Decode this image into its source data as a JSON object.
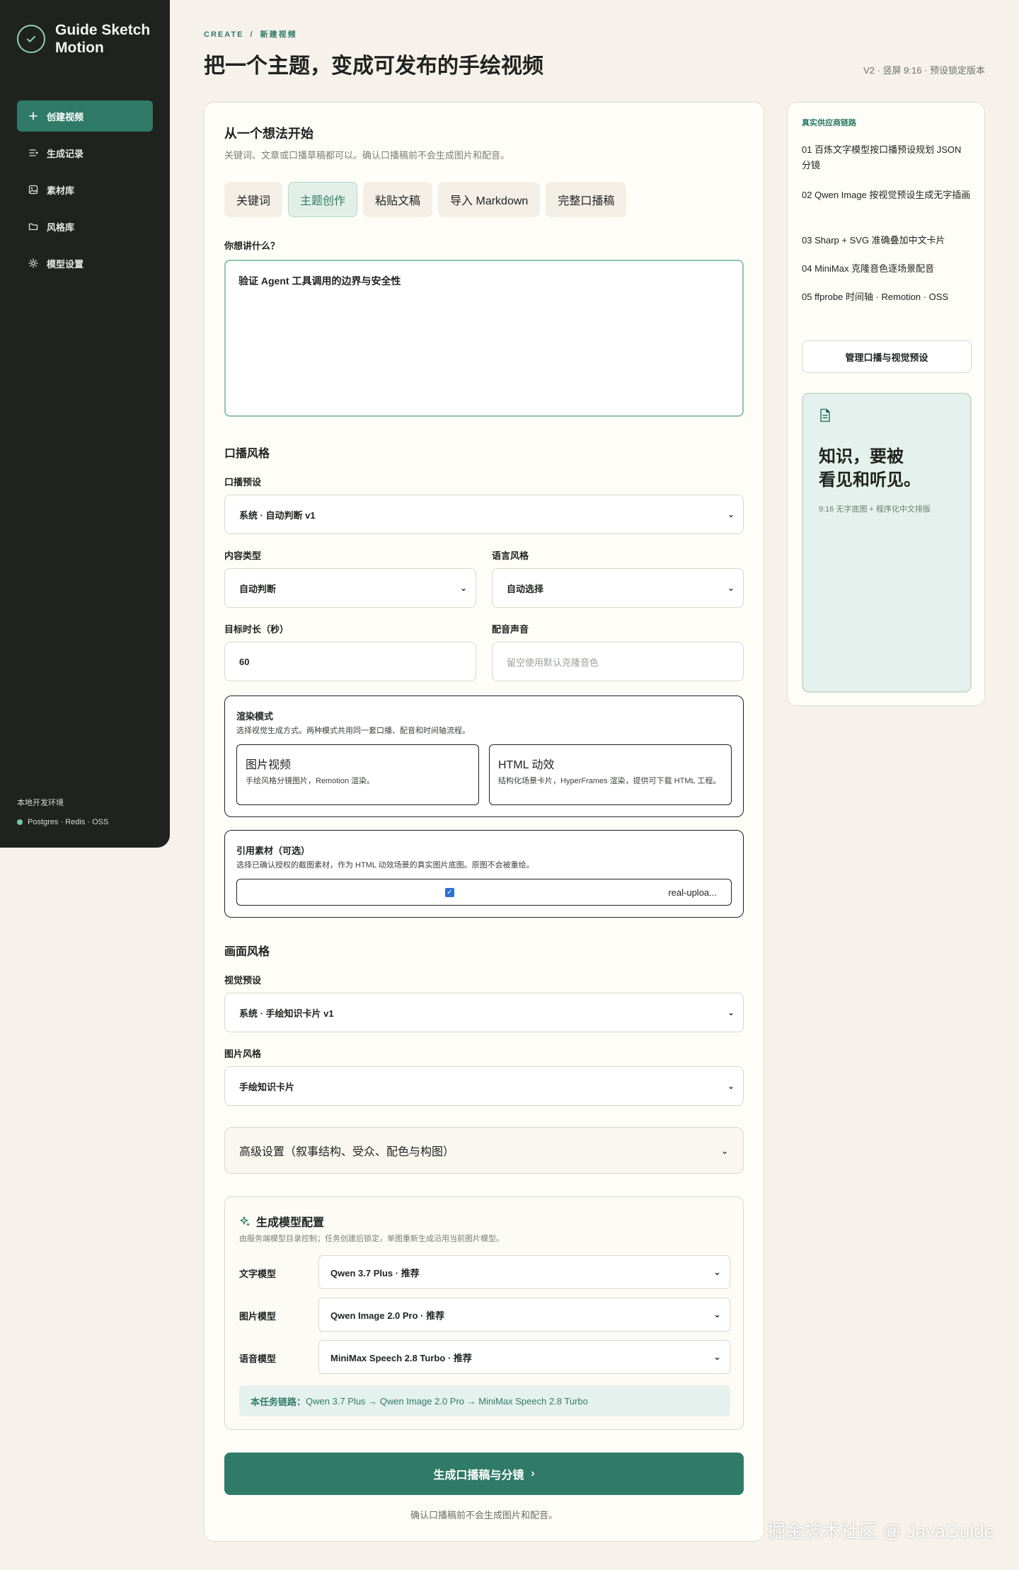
{
  "brand": {
    "name": "Guide Sketch Motion",
    "icon": "check-circle-icon"
  },
  "sidebar": {
    "items": [
      {
        "label": "创建视频",
        "icon": "plus-icon"
      },
      {
        "label": "生成记录",
        "icon": "list-icon"
      },
      {
        "label": "素材库",
        "icon": "image-icon"
      },
      {
        "label": "风格库",
        "icon": "folder-icon"
      },
      {
        "label": "模型设置",
        "icon": "gear-icon"
      }
    ],
    "env_label": "本地开发环境",
    "env_status": "Postgres · Redis · OSS"
  },
  "header": {
    "eyebrow_prefix": "CREATE",
    "eyebrow_sep": "/",
    "eyebrow_page": "新建视频",
    "title": "把一个主题，变成可发布的手绘视频",
    "version": "V2 · 竖屏 9:16 · 预设锁定版本"
  },
  "form": {
    "title": "从一个想法开始",
    "subtitle": "关键词、文章或口播草稿都可以。确认口播稿前不会生成图片和配音。",
    "tabs": [
      "关键词",
      "主题创作",
      "粘贴文稿",
      "导入 Markdown",
      "完整口播稿"
    ],
    "active_tab": "主题创作",
    "topic_label": "你想讲什么？",
    "topic_value": "验证 Agent 工具调用的边界与安全性",
    "voice_section": "口播风格",
    "voice_preset_label": "口播预设",
    "voice_preset_value": "系统 · 自动判断 v1",
    "content_type_label": "内容类型",
    "content_type_value": "自动判断",
    "language_label": "语言风格",
    "language_value": "自动选择",
    "duration_label": "目标时长（秒）",
    "duration_value": "60",
    "voice_label": "配音声音",
    "voice_placeholder": "留空使用默认克隆音色",
    "render": {
      "title": "渲染模式",
      "subtitle": "选择视觉生成方式。两种模式共用同一套口播、配音和时间轴流程。",
      "options": [
        {
          "title": "图片视频",
          "desc": "手绘风格分镜图片，Remotion 渲染。"
        },
        {
          "title": "HTML 动效",
          "desc": "结构化场景卡片，HyperFrames 渲染，提供可下载 HTML 工程。"
        }
      ]
    },
    "reference": {
      "title": "引用素材（可选）",
      "subtitle": "选择已确认授权的截图素材，作为 HTML 动效场景的真实图片底图。原图不会被重绘。",
      "item": "real-uploa..."
    },
    "visual_section": "画面风格",
    "visual_preset_label": "视觉预设",
    "visual_preset_value": "系统 · 手绘知识卡片 v1",
    "image_style_label": "图片风格",
    "image_style_value": "手绘知识卡片",
    "advanced_label": "高级设置（叙事结构、受众、配色与构图）",
    "models": {
      "title": "生成模型配置",
      "subtitle": "由服务端模型目录控制；任务创建后锁定，单图重新生成沿用当前图片模型。",
      "text_label": "文字模型",
      "text_value": "Qwen 3.7 Plus · 推荐",
      "image_label": "图片模型",
      "image_value": "Qwen Image 2.0 Pro · 推荐",
      "speech_label": "语音模型",
      "speech_value": "MiniMax Speech 2.8 Turbo · 推荐",
      "chain_label": "本任务链路：",
      "chain_value": "Qwen 3.7 Plus → Qwen Image 2.0 Pro → MiniMax Speech 2.8 Turbo"
    },
    "submit_label": "生成口播稿与分镜",
    "submit_note": "确认口播稿前不会生成图片和配音。"
  },
  "side": {
    "title": "真实供应商链路",
    "steps": [
      {
        "num": "01",
        "text": "百炼文字模型按口播预设规划 JSON 分镜"
      },
      {
        "num": "02",
        "text": "Qwen Image 按视觉预设生成无字插画"
      },
      {
        "num": "03",
        "text": "Sharp + SVG 准确叠加中文卡片"
      },
      {
        "num": "04",
        "text": "MiniMax 克隆音色逐场景配音"
      },
      {
        "num": "05",
        "text": "ffprobe 时间轴 · Remotion · OSS"
      }
    ],
    "manage_button": "管理口播与视觉预设",
    "preview_line1": "知识，要被",
    "preview_line2": "看见和听见。",
    "preview_sub": "9:16 无字底图 + 程序化中文排版"
  },
  "watermark": "掘金技术社区 @ JavaGuide"
}
